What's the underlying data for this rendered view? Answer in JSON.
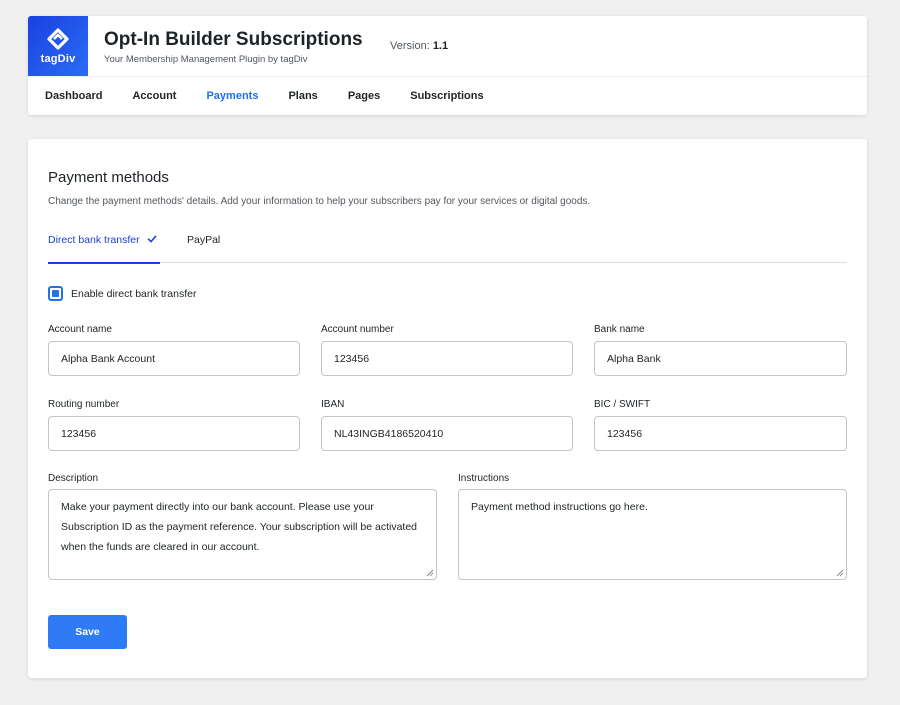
{
  "header": {
    "logo_text": "tagDiv",
    "title": "Opt-In Builder Subscriptions",
    "subtitle": "Your Membership Management Plugin by tagDiv",
    "version_label": "Version:",
    "version_value": "1.1"
  },
  "nav": {
    "items": [
      {
        "label": "Dashboard",
        "active": false
      },
      {
        "label": "Account",
        "active": false
      },
      {
        "label": "Payments",
        "active": true
      },
      {
        "label": "Plans",
        "active": false
      },
      {
        "label": "Pages",
        "active": false
      },
      {
        "label": "Subscriptions",
        "active": false
      }
    ]
  },
  "section": {
    "title": "Payment methods",
    "description": "Change the payment methods' details. Add your information to help your subscribers pay for your services or digital goods."
  },
  "tabs": [
    {
      "label": "Direct bank transfer",
      "active": true
    },
    {
      "label": "PayPal",
      "active": false
    }
  ],
  "enable_checkbox": {
    "label": "Enable direct bank transfer",
    "checked": true
  },
  "fields": {
    "account_name": {
      "label": "Account name",
      "value": "Alpha Bank Account"
    },
    "account_number": {
      "label": "Account number",
      "value": "123456"
    },
    "bank_name": {
      "label": "Bank name",
      "value": "Alpha Bank"
    },
    "routing_number": {
      "label": "Routing number",
      "value": "123456"
    },
    "iban": {
      "label": "IBAN",
      "value": "NL43INGB4186520410"
    },
    "bic_swift": {
      "label": "BIC / SWIFT",
      "value": "123456"
    },
    "description": {
      "label": "Description",
      "value": "Make your payment directly into our bank account. Please use your Subscription ID as the payment reference. Your subscription will be activated when the funds are cleared in our account."
    },
    "instructions": {
      "label": "Instructions",
      "value": "Payment method instructions go here."
    }
  },
  "save_label": "Save",
  "colors": {
    "accent": "#2271e8",
    "tab_active": "#1a3fd6",
    "button": "#2f7bf5",
    "logo": "#1a41e0"
  }
}
